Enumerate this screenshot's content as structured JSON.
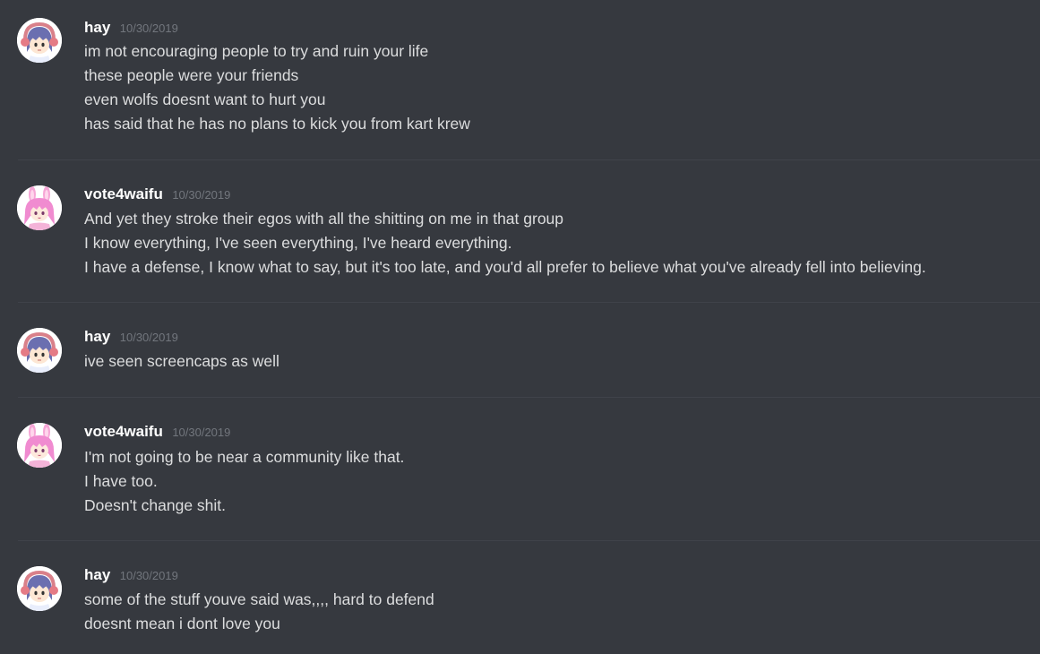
{
  "colors": {
    "background": "#36393f",
    "username": "#ffffff",
    "timestamp": "#72767d",
    "message_text": "#dcddde",
    "divider": "#40434a"
  },
  "messages": [
    {
      "author": "hay",
      "avatar_icon": "hay-avatar-icon",
      "timestamp": "10/30/2019",
      "lines": [
        "im not encouraging people to try and ruin your life",
        "these people were your friends",
        "even wolfs doesnt want to hurt you",
        "has said that he has no plans to kick you from kart krew"
      ]
    },
    {
      "author": "vote4waifu",
      "avatar_icon": "vote4waifu-avatar-icon",
      "timestamp": "10/30/2019",
      "lines": [
        "And yet they stroke their egos with all the shitting on me in that group",
        "I know everything, I've seen everything, I've heard everything.",
        "I have a defense, I know what to say, but it's too late, and you'd all prefer to believe what you've already fell into believing."
      ]
    },
    {
      "author": "hay",
      "avatar_icon": "hay-avatar-icon",
      "timestamp": "10/30/2019",
      "lines": [
        "ive seen screencaps as well"
      ]
    },
    {
      "author": "vote4waifu",
      "avatar_icon": "vote4waifu-avatar-icon",
      "timestamp": "10/30/2019",
      "lines": [
        "I'm not going to be near a community like that.",
        "I have too.",
        "Doesn't change shit."
      ]
    },
    {
      "author": "hay",
      "avatar_icon": "hay-avatar-icon",
      "timestamp": "10/30/2019",
      "lines": [
        "some of the stuff youve said was,,,, hard to defend",
        "doesnt mean i dont love you"
      ]
    }
  ]
}
